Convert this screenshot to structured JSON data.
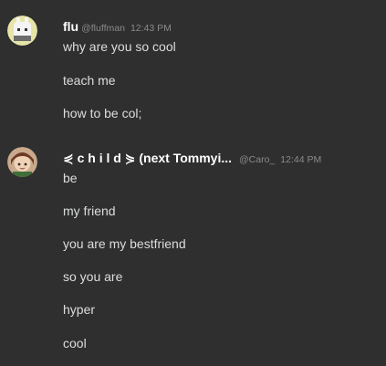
{
  "messages": [
    {
      "author": "flu",
      "handle": "@fluffman",
      "time": "12:43 PM",
      "avatar_icon": "white-bunny-avatar-icon",
      "lines": [
        "why are you so cool",
        "teach me",
        "how to be col;"
      ]
    },
    {
      "author": "⋞ c h i l d ⋟ (next Tommyi...",
      "handle": "@Caro_",
      "time": "12:44 PM",
      "avatar_icon": "brown-hair-character-avatar-icon",
      "lines": [
        "be",
        "my friend",
        "you are my bestfriend",
        "so you are",
        "hyper",
        "cool"
      ]
    }
  ],
  "colors": {
    "background": "#2f2f2f",
    "author": "#ffffff",
    "text": "#dcddde",
    "meta": "#8a8a8a"
  }
}
